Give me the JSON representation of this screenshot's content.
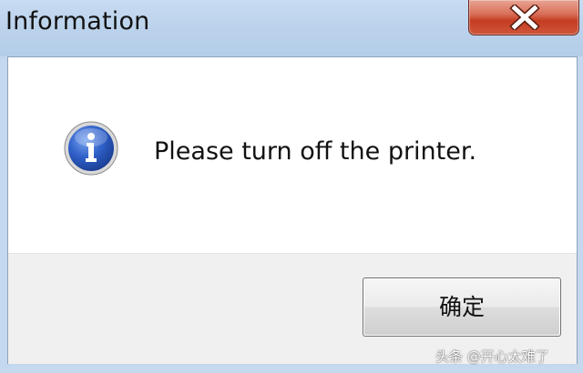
{
  "window": {
    "title": "Information"
  },
  "dialog": {
    "message": "Please turn off the printer.",
    "icon": "info-icon",
    "ok_label": "确定"
  },
  "watermark": {
    "text": "头条 @开心太难了"
  },
  "colors": {
    "titlebar": "#bcd3ec",
    "close_button": "#c43d22",
    "info_icon_blue": "#2d55b5",
    "footer": "#f0f0f0"
  }
}
